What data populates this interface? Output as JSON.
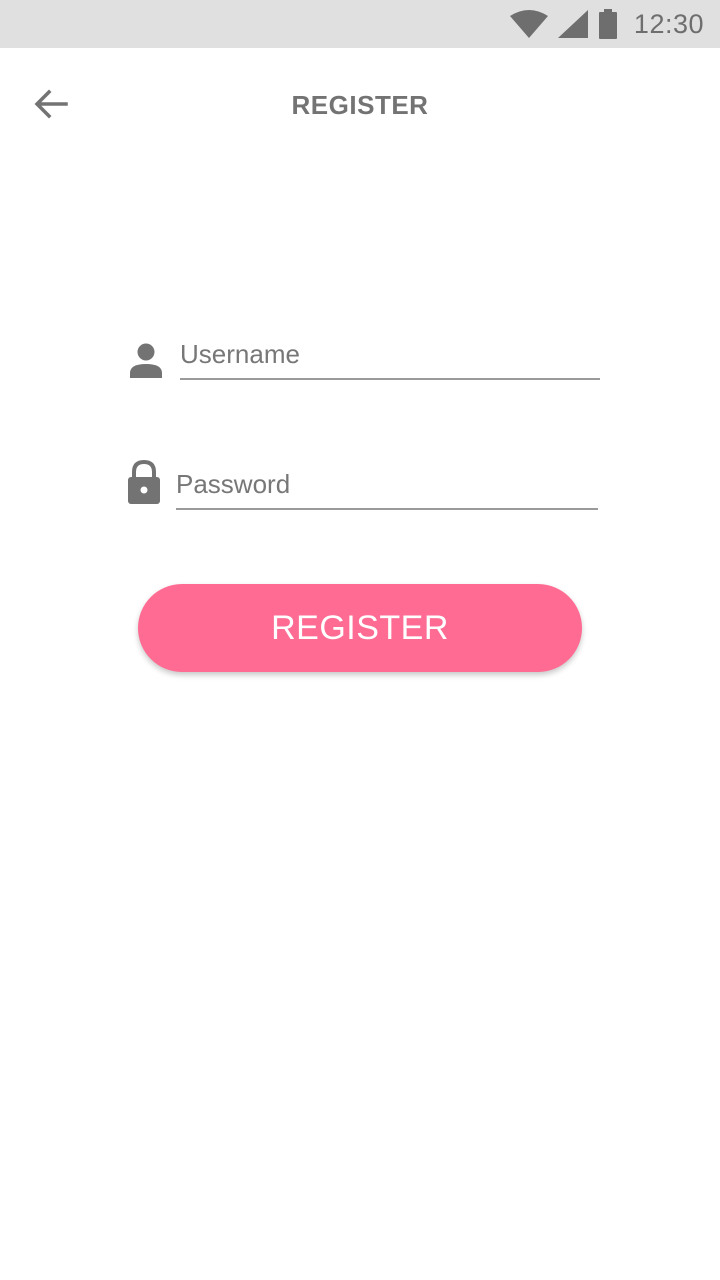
{
  "status_bar": {
    "time": "12:30",
    "icons": [
      "wifi-icon",
      "signal-icon",
      "battery-icon"
    ],
    "background": "#e0e0e0"
  },
  "app_bar": {
    "title": "REGISTER",
    "back_icon": "arrow-back-icon"
  },
  "form": {
    "username": {
      "placeholder": "Username",
      "value": "",
      "icon": "person-icon"
    },
    "password": {
      "placeholder": "Password",
      "value": "",
      "icon": "lock-icon"
    },
    "submit_label": "REGISTER"
  },
  "colors": {
    "accent": "#ff6b93",
    "icon": "#737373",
    "text": "#737373"
  }
}
